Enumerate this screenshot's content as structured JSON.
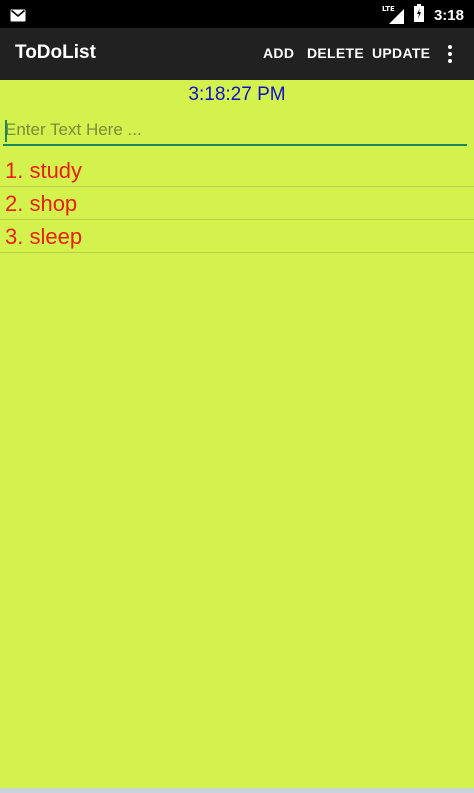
{
  "status_bar": {
    "time": "3:18",
    "network_label": "LTE",
    "icons": [
      "gmail-icon",
      "signal-icon",
      "battery-icon"
    ]
  },
  "app_bar": {
    "title": "ToDoList",
    "actions": {
      "add": "ADD",
      "delete": "DELETE",
      "update": "UPDATE"
    },
    "overflow_icon": "more-vert-icon"
  },
  "main": {
    "clock": "3:18:27 PM",
    "input": {
      "value": "",
      "placeholder": "Enter Text Here ..."
    },
    "items": [
      "1. study",
      "2. shop",
      "3. sleep"
    ]
  },
  "colors": {
    "background": "#d4f24e",
    "app_bar": "#212121",
    "clock_text": "#1010c8",
    "item_text": "#e8200a",
    "input_underline": "#1a8a5a"
  }
}
